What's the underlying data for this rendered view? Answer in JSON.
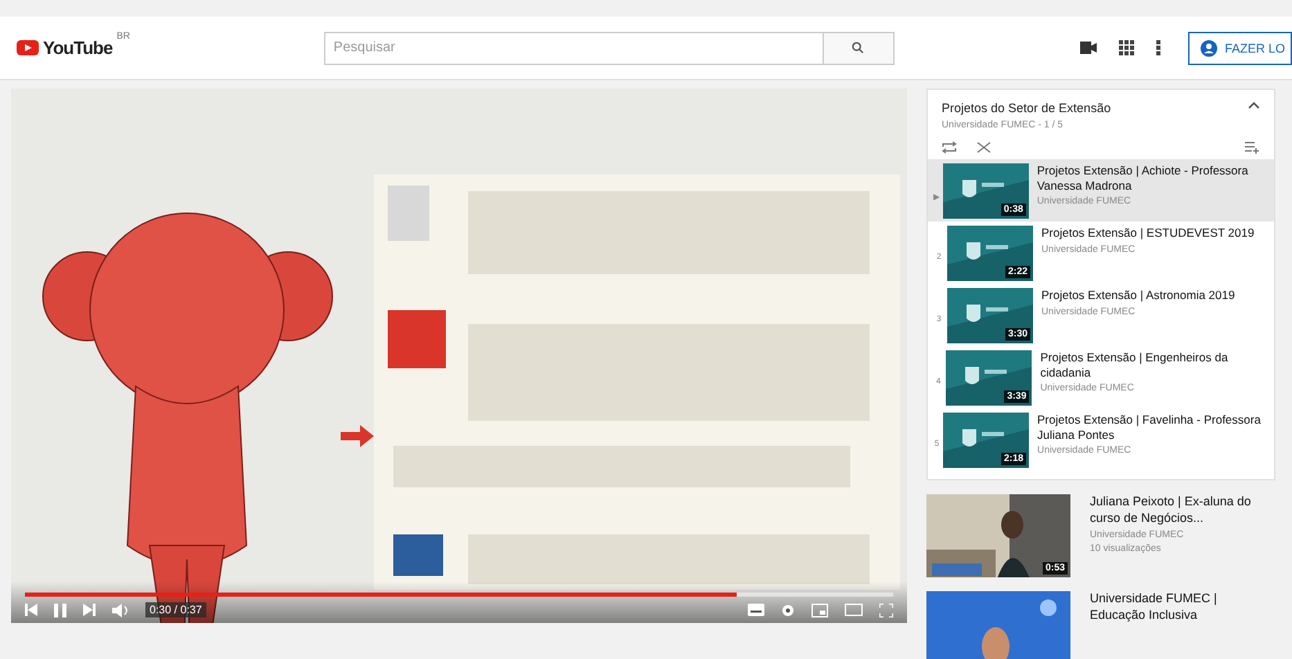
{
  "header": {
    "logo": "YouTube",
    "region": "BR",
    "search": {
      "placeholder": "Pesquisar"
    },
    "sign_in": "FAZER LO"
  },
  "player": {
    "kind": "picture",
    "progress": {
      "level": 0.82
    },
    "time": "0:30 / 0:37"
  },
  "playlist": {
    "title": "Projetos do Setor de Extensão",
    "subtitle": "Universidade FUMEC - 1 / 5",
    "items": [
      {
        "index": "▶",
        "title": "Projetos Extensão | Achiote - Professora Vanessa Madrona",
        "channel": "Universidade FUMEC",
        "duration": "0:38",
        "selected": true
      },
      {
        "index": "2",
        "title": "Projetos Extensão | ESTUDEVEST 2019",
        "channel": "Universidade FUMEC",
        "duration": "2:22",
        "selected": false
      },
      {
        "index": "3",
        "title": "Projetos Extensão | Astronomia 2019",
        "channel": "Universidade FUMEC",
        "duration": "3:30",
        "selected": false
      },
      {
        "index": "4",
        "title": "Projetos Extensão | Engenheiros da cidadania",
        "channel": "Universidade FUMEC",
        "duration": "3:39",
        "selected": false
      },
      {
        "index": "5",
        "title": "Projetos Extensão | Favelinha - Professora Juliana Pontes",
        "channel": "Universidade FUMEC",
        "duration": "2:18",
        "selected": false
      }
    ]
  },
  "recommended": [
    {
      "title": "Juliana Peixoto | Ex-aluna do curso de Negócios...",
      "channel": "Universidade FUMEC",
      "views": "10 visualizações",
      "duration": "0:53"
    },
    {
      "title": "Universidade FUMEC | Educação Inclusiva"
    }
  ]
}
